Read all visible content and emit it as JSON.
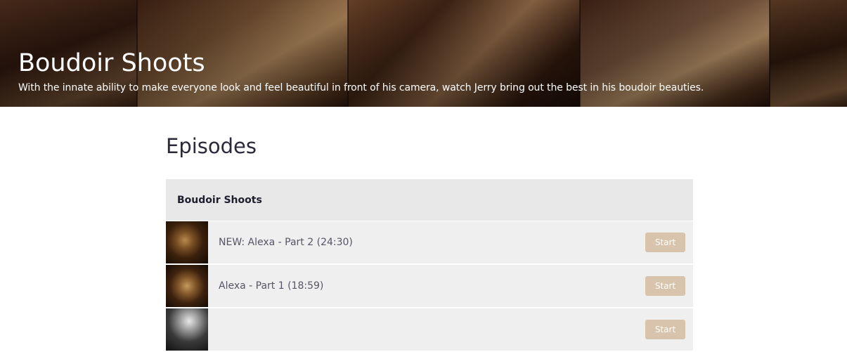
{
  "hero": {
    "title": "Boudoir Shoots",
    "subtitle": "With the innate ability to make everyone look and feel beautiful in front of his camera, watch Jerry bring out the best in his boudoir beauties."
  },
  "main": {
    "section_title": "Episodes",
    "season": {
      "title": "Boudoir Shoots",
      "episodes": [
        {
          "title": "NEW: Alexa - Part 2 (24:30)",
          "button": "Start"
        },
        {
          "title": "Alexa - Part 1 (18:59)",
          "button": "Start"
        },
        {
          "title": "",
          "button": "Start"
        }
      ]
    }
  },
  "colors": {
    "accent_button": "#d8c3ac",
    "season_header_bg": "#e8e8e8",
    "row_bg": "#efefef"
  }
}
